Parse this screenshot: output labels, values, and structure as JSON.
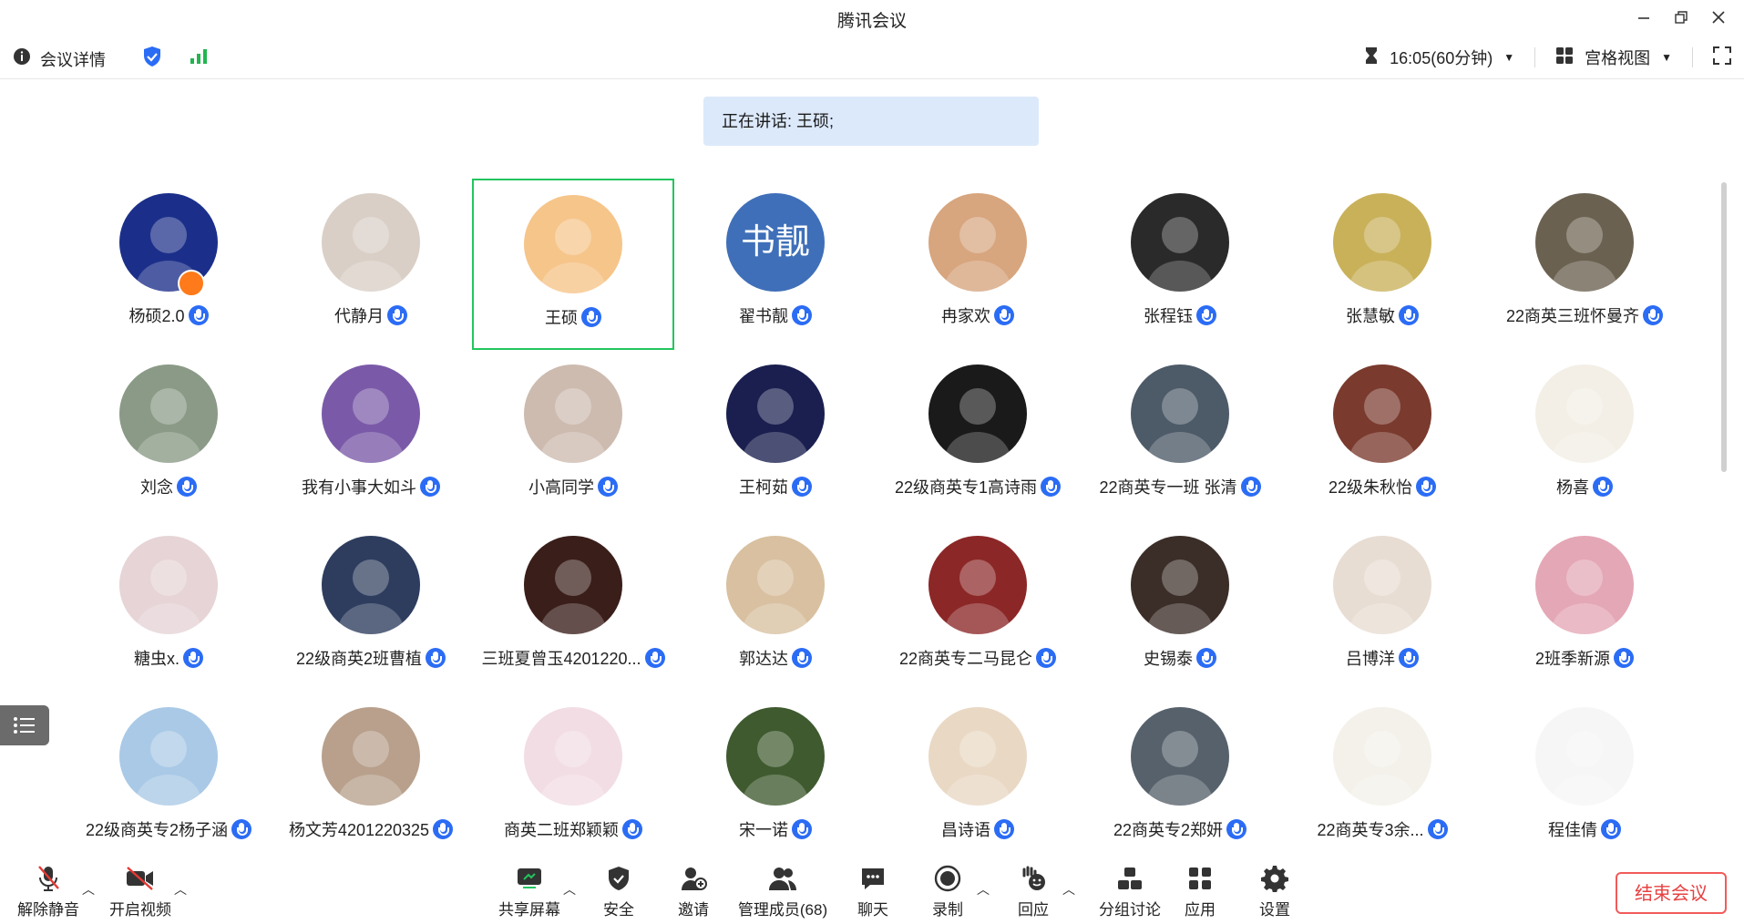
{
  "window": {
    "title": "腾讯会议"
  },
  "infobar": {
    "meeting_details": "会议详情",
    "time": "16:05(60分钟)",
    "view_mode": "宫格视图"
  },
  "speaking": "正在讲话: 王硕;",
  "participants": [
    {
      "name": "杨硕2.0",
      "color": "#1b2f8a"
    },
    {
      "name": "代静月",
      "color": "#d9cfc6"
    },
    {
      "name": "王硕",
      "color": "#f6c58a"
    },
    {
      "name": "翟书靓",
      "color": "#3f6fb8",
      "text": "书靓"
    },
    {
      "name": "冉家欢",
      "color": "#d7a57e"
    },
    {
      "name": "张程钰",
      "color": "#2a2a2a"
    },
    {
      "name": "张慧敏",
      "color": "#c9b15a"
    },
    {
      "name": "22商英三班怀曼齐",
      "color": "#6b6150"
    },
    {
      "name": "刘念",
      "color": "#8a9a86"
    },
    {
      "name": "我有小事大如斗",
      "color": "#7a5aa8"
    },
    {
      "name": "小高同学",
      "color": "#cdbbb0"
    },
    {
      "name": "王柯茹",
      "color": "#1a1f4f"
    },
    {
      "name": "22级商英专1高诗雨",
      "color": "#1a1a1a"
    },
    {
      "name": "22商英专一班 张清",
      "color": "#4d5a68"
    },
    {
      "name": "22级朱秋怡",
      "color": "#7a3a2e"
    },
    {
      "name": "杨喜",
      "color": "#f3efe6"
    },
    {
      "name": "糖虫x.",
      "color": "#e6d4d6"
    },
    {
      "name": "22级商英2班曹植",
      "color": "#2e3d5e"
    },
    {
      "name": "三班夏曾玉4201220...",
      "color": "#3a1e1a"
    },
    {
      "name": "郭达达",
      "color": "#d8c0a0"
    },
    {
      "name": "22商英专二马昆仑",
      "color": "#8c2727"
    },
    {
      "name": "史锡泰",
      "color": "#3b2e28"
    },
    {
      "name": "吕博洋",
      "color": "#e8ddd3"
    },
    {
      "name": "2班季新源",
      "color": "#e4a7b6"
    },
    {
      "name": "22级商英专2杨子涵",
      "color": "#a9c9e6"
    },
    {
      "name": "杨文芳4201220325",
      "color": "#b8a08c"
    },
    {
      "name": "商英二班郑颖颖",
      "color": "#f2dde4"
    },
    {
      "name": "宋一诺",
      "color": "#3f5a2f"
    },
    {
      "name": "昌诗语",
      "color": "#e9d8c4"
    },
    {
      "name": "22商英专2郑妍",
      "color": "#56616b"
    },
    {
      "name": "22商英专3余...",
      "color": "#f3f1ea"
    },
    {
      "name": "程佳倩",
      "color": "#f6f6f6"
    }
  ],
  "toolbar": {
    "unmute": "解除静音",
    "start_video": "开启视频",
    "share_screen": "共享屏幕",
    "security": "安全",
    "invite": "邀请",
    "manage_members": "管理成员(68)",
    "chat": "聊天",
    "record": "录制",
    "reaction": "回应",
    "breakout": "分组讨论",
    "apps": "应用",
    "settings": "设置",
    "end_meeting": "结束会议"
  }
}
